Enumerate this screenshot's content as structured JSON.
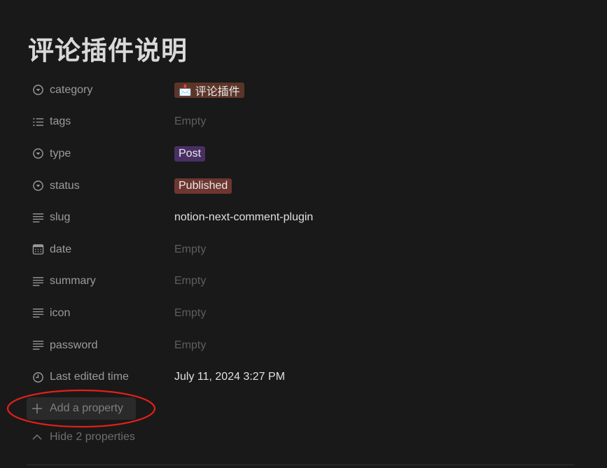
{
  "page": {
    "title": "评论插件说明"
  },
  "properties": [
    {
      "name": "category",
      "icon": "select-icon",
      "kind": "tag",
      "value": "评论插件",
      "emoji": "📩",
      "color": "#5c3529"
    },
    {
      "name": "tags",
      "icon": "list-icon",
      "kind": "empty",
      "value": "Empty"
    },
    {
      "name": "type",
      "icon": "select-icon",
      "kind": "tag",
      "value": "Post",
      "color": "#492f64"
    },
    {
      "name": "status",
      "icon": "select-icon",
      "kind": "tag",
      "value": "Published",
      "color": "#6e3630"
    },
    {
      "name": "slug",
      "icon": "text-icon",
      "kind": "text",
      "value": "notion-next-comment-plugin"
    },
    {
      "name": "date",
      "icon": "calendar-icon",
      "kind": "empty",
      "value": "Empty"
    },
    {
      "name": "summary",
      "icon": "text-icon",
      "kind": "empty",
      "value": "Empty"
    },
    {
      "name": "icon",
      "icon": "text-icon",
      "kind": "empty",
      "value": "Empty"
    },
    {
      "name": "password",
      "icon": "text-icon",
      "kind": "empty",
      "value": "Empty"
    },
    {
      "name": "Last edited time",
      "icon": "clock-icon",
      "kind": "text",
      "value": "July 11, 2024 3:27 PM"
    }
  ],
  "actions": {
    "add_property": "Add a property",
    "hide_properties": "Hide 2 properties"
  },
  "colors": {
    "background": "#191919",
    "annotation": "#e0201b"
  }
}
